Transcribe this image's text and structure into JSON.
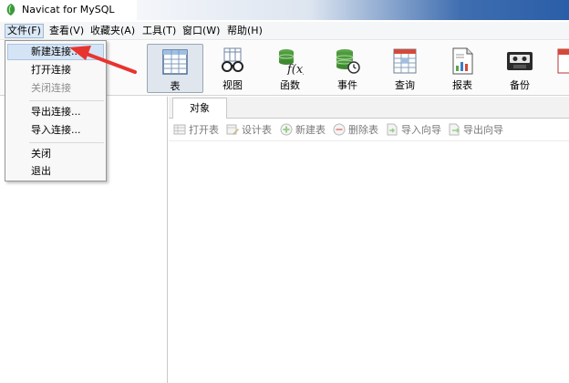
{
  "window": {
    "title": "Navicat for MySQL"
  },
  "menubar": [
    {
      "label": "文件(F)"
    },
    {
      "label": "查看(V)"
    },
    {
      "label": "收藏夹(A)"
    },
    {
      "label": "工具(T)"
    },
    {
      "label": "窗口(W)"
    },
    {
      "label": "帮助(H)"
    }
  ],
  "file_menu": {
    "items": [
      {
        "label": "新建连接..."
      },
      {
        "label": "打开连接"
      },
      {
        "label": "关闭连接"
      },
      {
        "label": "导出连接..."
      },
      {
        "label": "导入连接..."
      },
      {
        "label": "关闭"
      },
      {
        "label": "退出"
      }
    ]
  },
  "toolbar": [
    {
      "label": "表",
      "icon": "table-icon"
    },
    {
      "label": "视图",
      "icon": "view-glasses-icon"
    },
    {
      "label": "函数",
      "icon": "function-icon"
    },
    {
      "label": "事件",
      "icon": "event-database-clock-icon"
    },
    {
      "label": "查询",
      "icon": "query-icon"
    },
    {
      "label": "报表",
      "icon": "report-icon"
    },
    {
      "label": "备份",
      "icon": "backup-cassette-icon"
    }
  ],
  "tabs": [
    {
      "label": "对象"
    }
  ],
  "object_toolbar": [
    {
      "label": "打开表"
    },
    {
      "label": "设计表"
    },
    {
      "label": "新建表"
    },
    {
      "label": "删除表"
    },
    {
      "label": "导入向导"
    },
    {
      "label": "导出向导"
    }
  ],
  "colors": {
    "selection": "#d5e4f4",
    "annotation_arrow": "#e8342f",
    "disabled_text": "#8d8d8d"
  }
}
